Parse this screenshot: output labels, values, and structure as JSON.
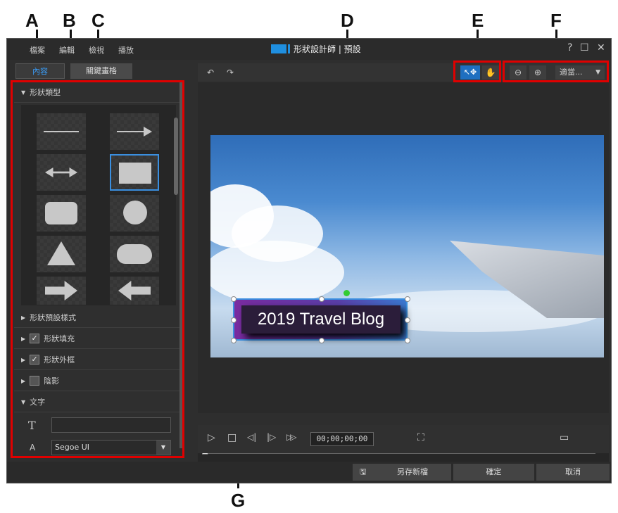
{
  "callouts": {
    "a": "A",
    "b": "B",
    "c": "C",
    "d": "D",
    "e": "E",
    "f": "F",
    "g": "G"
  },
  "menu": {
    "file": "檔案",
    "edit": "編輯",
    "view": "檢視",
    "play": "播放"
  },
  "window": {
    "title": "形狀設計師 | 預設",
    "help": "?",
    "maximize": "☐",
    "close": "✕"
  },
  "tabs": {
    "content": "內容",
    "keyframes": "關鍵畫格"
  },
  "sections": {
    "shape_type": "形狀類型",
    "shape_preset": "形狀預設樣式",
    "shape_fill": "形狀填充",
    "shape_border": "形狀外框",
    "shadow": "陰影",
    "text": "文字"
  },
  "checks": {
    "fill": true,
    "border": true,
    "shadow": false
  },
  "text_panel": {
    "text_icon": "T",
    "font_icon": "A",
    "font_value": "Segoe UI"
  },
  "toolbar": {
    "undo": "↶",
    "redo": "↷",
    "select": "↖✥",
    "hand": "✋",
    "zoom_out": "⊖",
    "zoom_in": "⊕",
    "zoom_select": "適當...",
    "dropdown": "▼"
  },
  "preview": {
    "shape_text": "2019 Travel Blog"
  },
  "controls": {
    "play": "▷",
    "stop": "□",
    "prev_frame": "◁|",
    "next_frame": "|▷",
    "fast_forward": "▷▷",
    "timecode": "00;00;00;00",
    "fullscreen": "⛶",
    "display": "▭"
  },
  "buttons": {
    "save_as_icon": "🖫",
    "save_as": "另存新檔",
    "ok": "確定",
    "cancel": "取消"
  },
  "colors": {
    "highlight": "#e00000",
    "accent": "#3a8fe0"
  }
}
